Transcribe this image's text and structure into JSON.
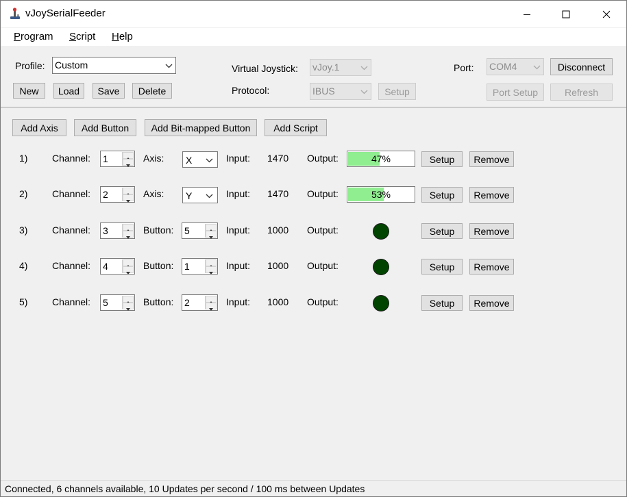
{
  "window": {
    "title": "vJoySerialFeeder"
  },
  "menu": {
    "program": "Program",
    "program_accel": "P",
    "program_rest": "rogram",
    "script_accel": "S",
    "script_rest": "cript",
    "help_accel": "H",
    "help_rest": "elp"
  },
  "profile": {
    "label": "Profile:",
    "value": "Custom",
    "new_label": "New",
    "load_label": "Load",
    "save_label": "Save",
    "delete_label": "Delete"
  },
  "joystick": {
    "virtual_label": "Virtual Joystick:",
    "virtual_value": "vJoy.1",
    "protocol_label": "Protocol:",
    "protocol_value": "IBUS",
    "setup_label": "Setup"
  },
  "port": {
    "label": "Port:",
    "value": "COM4",
    "disconnect_label": "Disconnect",
    "port_setup_label": "Port Setup",
    "refresh_label": "Refresh"
  },
  "toolbar": {
    "add_axis": "Add Axis",
    "add_button": "Add Button",
    "add_bitmapped": "Add Bit-mapped Button",
    "add_script": "Add Script"
  },
  "mapping_labels": {
    "channel": "Channel:",
    "axis": "Axis:",
    "button": "Button:",
    "input": "Input:",
    "output": "Output:",
    "setup": "Setup",
    "remove": "Remove"
  },
  "mappings": [
    {
      "index": "1)",
      "channel": "1",
      "kind": "axis",
      "target": "X",
      "input": "1470",
      "output_text": "47%",
      "output_fraction": 0.47
    },
    {
      "index": "2)",
      "channel": "2",
      "kind": "axis",
      "target": "Y",
      "input": "1470",
      "output_text": "53%",
      "output_fraction": 0.53
    },
    {
      "index": "3)",
      "channel": "3",
      "kind": "button",
      "target": "5",
      "input": "1000",
      "output_state": "off"
    },
    {
      "index": "4)",
      "channel": "4",
      "kind": "button",
      "target": "1",
      "input": "1000",
      "output_state": "off"
    },
    {
      "index": "5)",
      "channel": "5",
      "kind": "button",
      "target": "2",
      "input": "1000",
      "output_state": "off"
    }
  ],
  "colors": {
    "progress_fill": "#90ee90",
    "led_off": "#004400"
  },
  "status": {
    "text": "Connected, 6 channels available, 10 Updates per second / 100 ms between Updates"
  }
}
